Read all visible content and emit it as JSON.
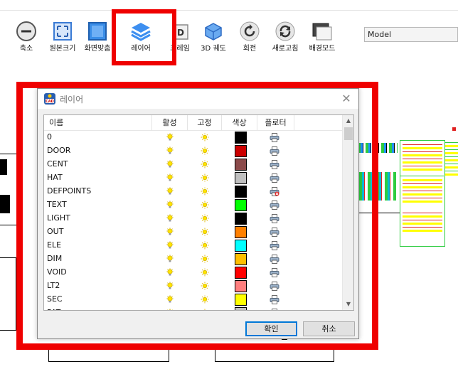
{
  "toolbar": {
    "buttons": [
      {
        "label": "축소",
        "icon": "zoom-out-icon"
      },
      {
        "label": "원본크기",
        "icon": "original-size-icon"
      },
      {
        "label": "화면맞춤",
        "icon": "fit-screen-icon"
      },
      {
        "label": "레이어",
        "icon": "layers-icon"
      },
      {
        "label": "프레임",
        "icon": "frame-icon"
      },
      {
        "label": "3D 궤도",
        "icon": "3d-orbit-icon"
      },
      {
        "label": "회전",
        "icon": "rotate-icon"
      },
      {
        "label": "새로고침",
        "icon": "refresh-icon"
      },
      {
        "label": "배경모드",
        "icon": "background-mode-icon"
      }
    ],
    "model_select": "Model"
  },
  "dialog": {
    "title": "레이어",
    "columns": [
      "이름",
      "활성",
      "고정",
      "색상",
      "플로터"
    ],
    "layers": [
      {
        "name": "0",
        "color": "#000000",
        "plot": true
      },
      {
        "name": "DOOR",
        "color": "#cc0000",
        "plot": true
      },
      {
        "name": "CENT",
        "color": "#8b4a4a",
        "plot": true
      },
      {
        "name": "HAT",
        "color": "#c0c0c0",
        "plot": true
      },
      {
        "name": "DEFPOINTS",
        "color": "#000000",
        "plot": false
      },
      {
        "name": "TEXT",
        "color": "#00ff00",
        "plot": true
      },
      {
        "name": "LIGHT",
        "color": "#000000",
        "plot": true
      },
      {
        "name": "OUT",
        "color": "#ff8000",
        "plot": true
      },
      {
        "name": "ELE",
        "color": "#00ffff",
        "plot": true
      },
      {
        "name": "DIM",
        "color": "#ffbf00",
        "plot": true
      },
      {
        "name": "VOID",
        "color": "#ff0000",
        "plot": true
      },
      {
        "name": "LT2",
        "color": "#ff7f7f",
        "plot": true
      },
      {
        "name": "SEC",
        "color": "#ffff00",
        "plot": true
      },
      {
        "name": "PAT",
        "color": "#c0c0c0",
        "plot": true
      }
    ],
    "ok_label": "확인",
    "cancel_label": "취소"
  },
  "accent_color": "#ef0000"
}
